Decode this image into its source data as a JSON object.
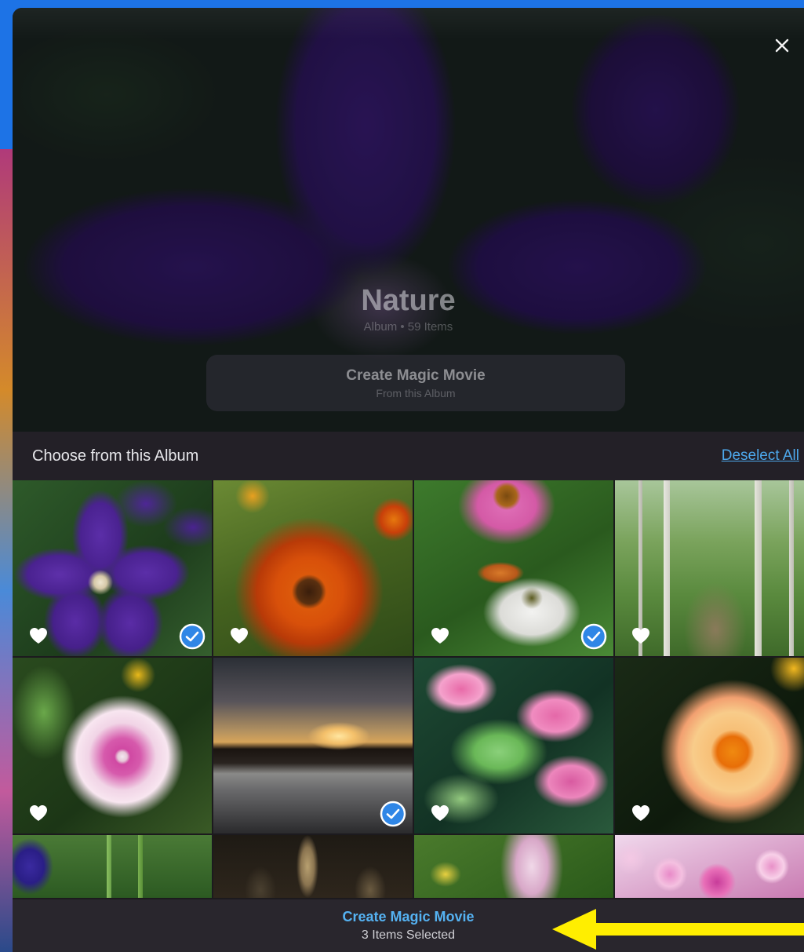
{
  "album": {
    "title": "Nature",
    "subtitle": "Album • 59 Items",
    "hero_button": {
      "title": "Create Magic Movie",
      "subtitle": "From this Album"
    }
  },
  "icons": {
    "close": "close-icon",
    "favorite": "heart-icon",
    "selected": "checkmark-circle-icon"
  },
  "section": {
    "title": "Choose from this Album",
    "deselect_label": "Deselect All"
  },
  "photos": [
    {
      "subject": "clematis",
      "selected": true,
      "favorite": true
    },
    {
      "subject": "rudbeckia",
      "selected": false,
      "favorite": true
    },
    {
      "subject": "coneflower-butterfly",
      "selected": true,
      "favorite": true
    },
    {
      "subject": "birch-path",
      "selected": false,
      "favorite": true
    },
    {
      "subject": "mallow",
      "selected": false,
      "favorite": true
    },
    {
      "subject": "sunset-lake",
      "selected": true,
      "favorite": false
    },
    {
      "subject": "anthurium",
      "selected": false,
      "favorite": true
    },
    {
      "subject": "zinnia",
      "selected": false,
      "favorite": true
    },
    {
      "subject": "lavender",
      "selected": false,
      "favorite": false
    },
    {
      "subject": "cactus",
      "selected": false,
      "favorite": false
    },
    {
      "subject": "iris",
      "selected": false,
      "favorite": false
    },
    {
      "subject": "pansies",
      "selected": false,
      "favorite": false
    }
  ],
  "bottom_bar": {
    "action_label": "Create Magic Movie",
    "count_label": "3 Items Selected"
  },
  "annotation": {
    "arrow_color": "#ffee00"
  },
  "colors": {
    "accent": "#4da8ec",
    "background": "#1d73e6"
  }
}
